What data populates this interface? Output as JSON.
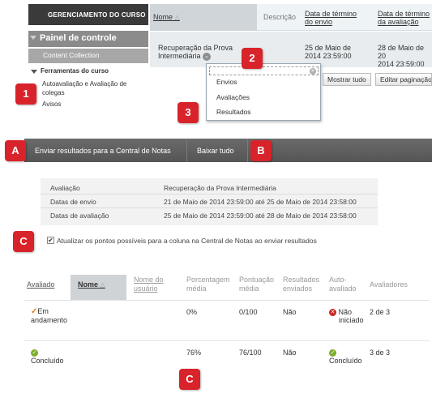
{
  "sidebar": {
    "header": "GERENCIAMENTO DO CURSO",
    "panel": "Painel de controle",
    "content_collection": "Content Collection",
    "tools": "Ferramentas do curso",
    "links": [
      "Autoavaliação e Avaliação de",
      "colegas",
      "Avisos"
    ]
  },
  "top_table": {
    "headers": {
      "name": "Nome",
      "description": "Descrição",
      "send_end_1": "Data de término",
      "send_end_2": "do envio",
      "eval_end_1": "Data de término",
      "eval_end_2": "da avaliação"
    },
    "row": {
      "name_1": "Recuperação da Prova",
      "name_2": "Intermediária",
      "send_date_1": "25 de Maio de",
      "send_date_2": "2014 23:59:00",
      "eval_date_1": "28 de Maio de 20",
      "eval_date_2": "2014 23:59:00"
    },
    "buttons": {
      "show_all": "Mostrar tudo",
      "edit_paging": "Editar paginação"
    }
  },
  "dropdown": {
    "items": [
      "Envios",
      "Avaliações",
      "Resultados"
    ]
  },
  "callouts": {
    "c1": "1",
    "c2": "2",
    "c3": "3",
    "cA": "A",
    "cB": "B",
    "cC1": "C",
    "cC2": "C"
  },
  "action_bar": {
    "send_results": "Enviar resultados para a Central de Notas",
    "download_all": "Baixar tudo"
  },
  "info": {
    "rows": [
      {
        "label": "Avaliação",
        "value": "Recuperação da Prova Intermediária"
      },
      {
        "label": "Datas de envio",
        "value": "21 de Maio de 2014 23:59:00 até 25 de Maio de 2014 23:58:00"
      },
      {
        "label": "Datas de avaliação",
        "value": "25 de Maio de 2014 23:59:00 até 28 de Maio de 2014 23:58:00"
      }
    ]
  },
  "checkbox": {
    "label": "Atualizar os pontos possíveis para a coluna na Central de Notas ao enviar resultados",
    "checked_glyph": "✔"
  },
  "bottom_table": {
    "headers": {
      "evaluated": "Avaliado",
      "name": "Nome",
      "username_1": "Nome do",
      "username_2": "usuário",
      "percent_1": "Porcentagem",
      "percent_2": "média",
      "score_1": "Pontuação",
      "score_2": "média",
      "results_1": "Resultados",
      "results_2": "enviados",
      "self_1": "Auto-",
      "self_2": "avaliado",
      "evaluators": "Avaliadores"
    },
    "rows": [
      {
        "status_1": "Em",
        "status_2": "andamento",
        "percent": "0%",
        "score": "0/100",
        "results": "Não",
        "self_1": "Não",
        "self_2": "iniciado",
        "evaluators": "2 de 3"
      },
      {
        "status_1": "Concluído",
        "percent": "76%",
        "score": "76/100",
        "results": "Não",
        "self_1": "Concluído",
        "evaluators": "3 de 3"
      }
    ]
  },
  "colors": {
    "callout": "#d8232a",
    "bar": "#5e5e5e",
    "success": "#7cae2b",
    "danger": "#c8261f",
    "progress": "#e07a1a"
  }
}
